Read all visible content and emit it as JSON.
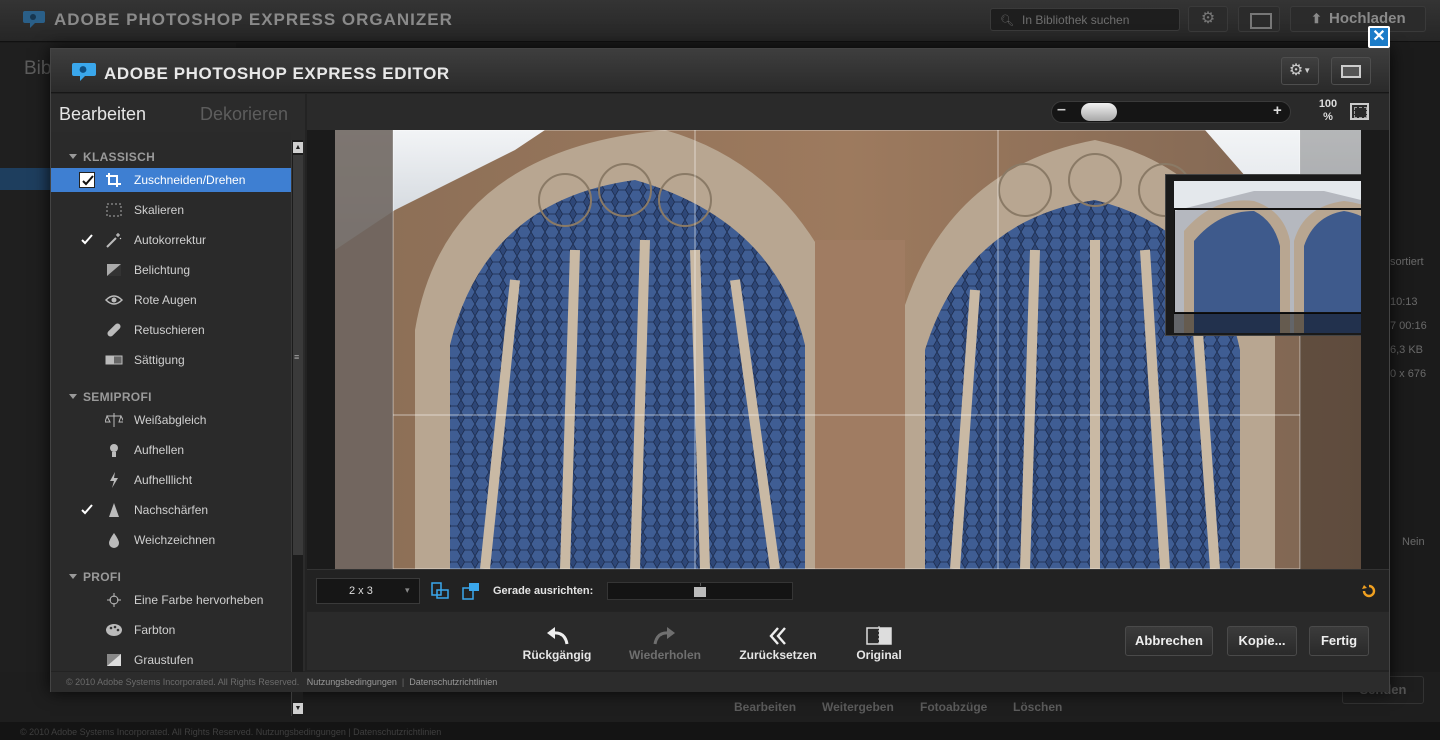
{
  "organizer": {
    "title": "ADOBE PHOTOSHOP EXPRESS ORGANIZER",
    "search_placeholder": "In Bibliothek suchen",
    "upload_label": "Hochladen",
    "library_label": "Bib",
    "right_texts": [
      "sortiert",
      "10:13",
      "7 00:16",
      "6,3 KB",
      "0 x 676",
      "Nein"
    ],
    "bottom_items": [
      "Bearbeiten",
      "Weitergeben",
      "Fotoabzüge",
      "Löschen"
    ],
    "send_label": "Senden",
    "footer": "© 2010 Adobe Systems Incorporated. All Rights Reserved.   Nutzungsbedingungen  |  Datenschutzrichtlinien"
  },
  "editor": {
    "title": "ADOBE PHOTOSHOP EXPRESS EDITOR",
    "tabs": {
      "edit": "Bearbeiten",
      "decorate": "Dekorieren"
    },
    "categories": {
      "classic": "KLASSISCH",
      "semipro": "SEMIPROFI",
      "pro": "PROFI"
    },
    "items": [
      {
        "label": "Zuschneiden/Drehen",
        "icon": "crop-icon",
        "checked": true,
        "selected": true
      },
      {
        "label": "Skalieren",
        "icon": "resize-icon",
        "checked": false
      },
      {
        "label": "Autokorrektur",
        "icon": "magic-wand-icon",
        "checked": true
      },
      {
        "label": "Belichtung",
        "icon": "exposure-icon",
        "checked": false
      },
      {
        "label": "Rote Augen",
        "icon": "eye-icon",
        "checked": false
      },
      {
        "label": "Retuschieren",
        "icon": "bandage-icon",
        "checked": false
      },
      {
        "label": "Sättigung",
        "icon": "saturation-icon",
        "checked": false
      },
      {
        "label": "Weißabgleich",
        "icon": "balance-icon",
        "checked": false
      },
      {
        "label": "Aufhellen",
        "icon": "bulb-icon",
        "checked": false
      },
      {
        "label": "Aufhelllicht",
        "icon": "lightning-icon",
        "checked": false
      },
      {
        "label": "Nachschärfen",
        "icon": "sharpen-icon",
        "checked": true
      },
      {
        "label": "Weichzeichnen",
        "icon": "drop-icon",
        "checked": false
      },
      {
        "label": "Eine Farbe hervorheben",
        "icon": "target-icon",
        "checked": false
      },
      {
        "label": "Farbton",
        "icon": "palette-icon",
        "checked": false
      },
      {
        "label": "Graustufen",
        "icon": "grayscale-icon",
        "checked": false
      }
    ],
    "zoom": {
      "value": "100",
      "unit": "%",
      "minus": "–",
      "plus": "+",
      "level": 0.1
    },
    "tools": {
      "ratio": "2 x 3",
      "straighten_label": "Gerade ausrichten:",
      "straighten_level": 0.5
    },
    "actions": {
      "undo": "Rückgängig",
      "redo": "Wiederholen",
      "reset": "Zurücksetzen",
      "original": "Original"
    },
    "buttons": {
      "cancel": "Abbrechen",
      "copy": "Kopie...",
      "done": "Fertig"
    },
    "footer": {
      "copyright": "© 2010 Adobe Systems Incorporated. All Rights Reserved.",
      "terms": "Nutzungsbedingungen",
      "sep": "|",
      "privacy": "Datenschutzrichtlinien"
    },
    "close": "✕"
  },
  "colors": {
    "selection": "#3e7fd2",
    "close_button": "#1c7cc8",
    "accent_orange": "#f0a020"
  }
}
